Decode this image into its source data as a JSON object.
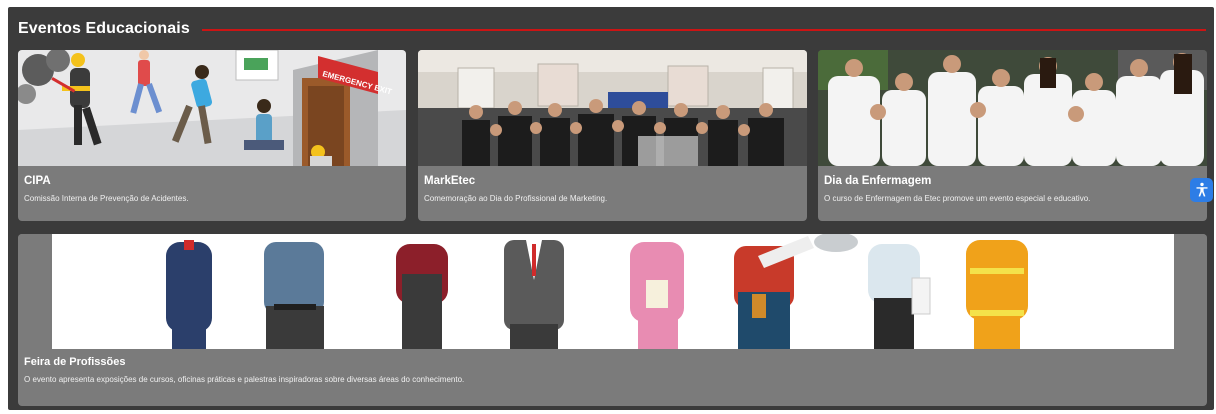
{
  "section": {
    "title": "Eventos Educacionais"
  },
  "cards": [
    {
      "title": "CIPA",
      "description": "Comissão Interna de Prevenção de Acidentes.",
      "image": "emergency-evacuation-illustration"
    },
    {
      "title": "MarkEtec",
      "description": "Comemoração ao Dia do Profissional de Marketing.",
      "image": "marketing-group-photo"
    },
    {
      "title": "Dia da Enfermagem",
      "description": "O curso de Enfermagem da Etec promove um evento especial e educativo.",
      "image": "nursing-students-photo"
    },
    {
      "title": "Feira de Profissões",
      "description": "O evento apresenta exposições de cursos, oficinas práticas e palestras inspiradoras sobre diversas áreas do conhecimento.",
      "image": "professions-illustration"
    }
  ],
  "photo_text": {
    "emergency_exit": "EMERGENCY EXIT"
  },
  "accessibility": {
    "icon": "accessibility-icon"
  },
  "colors": {
    "panel": "#3b3b3b",
    "card": "#7b7b7b",
    "accent_rule": "#cc1414",
    "accessibility_button": "#2d7de6"
  }
}
